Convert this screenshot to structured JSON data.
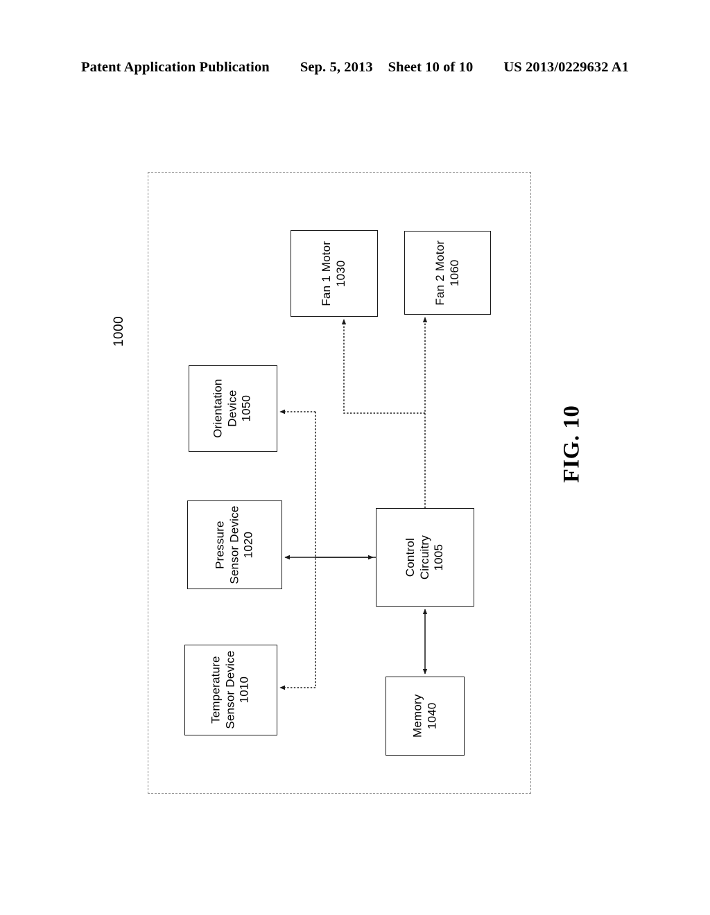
{
  "header": {
    "publication": "Patent Application Publication",
    "date": "Sep. 5, 2013",
    "sheet": "Sheet 10 of 10",
    "document_number": "US 2013/0229632 A1"
  },
  "figure": {
    "caption": "FIG. 10",
    "system_reference": "1000",
    "blocks": [
      {
        "id": "fan-1-motor",
        "line1": "Fan 1 Motor",
        "line2": "1030",
        "line3": ""
      },
      {
        "id": "fan-2-motor",
        "line1": "Fan 2 Motor",
        "line2": "1060",
        "line3": ""
      },
      {
        "id": "orientation-device",
        "line1": "Orientation",
        "line2": "Device",
        "line3": "1050"
      },
      {
        "id": "pressure-sensor-device",
        "line1": "Pressure",
        "line2": "Sensor Device",
        "line3": "1020"
      },
      {
        "id": "temperature-sensor-device",
        "line1": "Temperature",
        "line2": "Sensor Device",
        "line3": "1010"
      },
      {
        "id": "control-circuitry",
        "line1": "Control",
        "line2": "Circuitry",
        "line3": "1005"
      },
      {
        "id": "memory",
        "line1": "Memory",
        "line2": "1040",
        "line3": ""
      }
    ],
    "colors": {
      "line": "#1a1a1a",
      "boundary": "#8d8d8d",
      "background": "#ffffff"
    }
  }
}
